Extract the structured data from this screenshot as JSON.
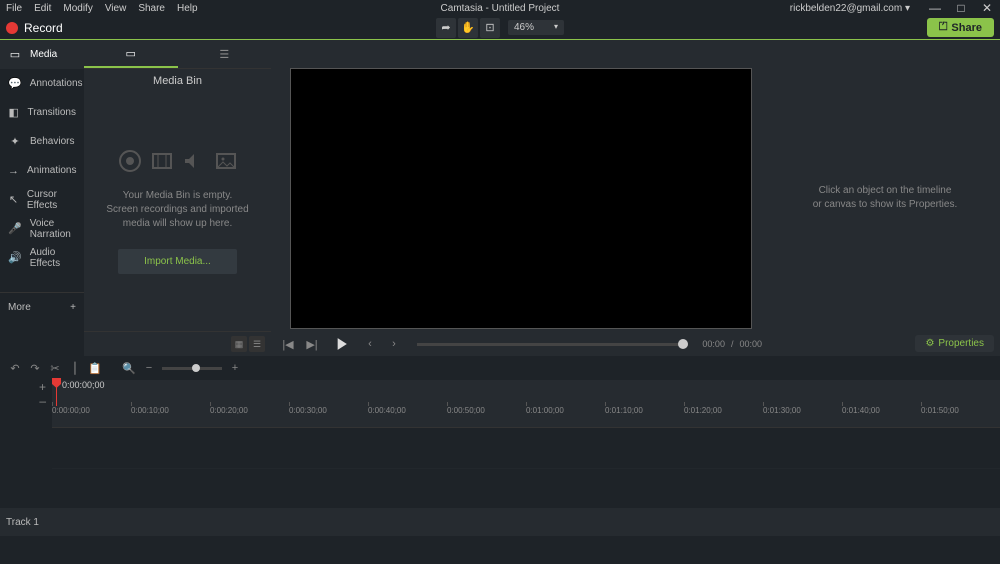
{
  "menu": [
    "File",
    "Edit",
    "Modify",
    "View",
    "Share",
    "Help"
  ],
  "title": "Camtasia - Untitled Project",
  "account": {
    "email": "rickbelden22@gmail.com"
  },
  "record": {
    "label": "Record"
  },
  "canvas_toolbar": {
    "zoom": "46%"
  },
  "share": {
    "label": "Share"
  },
  "sidebar": {
    "items": [
      {
        "label": "Media"
      },
      {
        "label": "Annotations"
      },
      {
        "label": "Transitions"
      },
      {
        "label": "Behaviors"
      },
      {
        "label": "Animations"
      },
      {
        "label": "Cursor Effects"
      },
      {
        "label": "Voice Narration"
      },
      {
        "label": "Audio Effects"
      }
    ],
    "more": "More"
  },
  "panel": {
    "title": "Media Bin",
    "empty_line1": "Your Media Bin is empty.",
    "empty_line2": "Screen recordings and imported",
    "empty_line3": "media will show up here.",
    "import": "Import Media..."
  },
  "properties": {
    "placeholder_line1": "Click an object on the timeline",
    "placeholder_line2": "or canvas to show its Properties.",
    "button": "Properties"
  },
  "playback": {
    "current": "00:00",
    "sep": "/",
    "total": "00:00"
  },
  "timeline": {
    "playhead": "0:00:00;00",
    "ticks": [
      "0:00:00;00",
      "0:00:10;00",
      "0:00:20;00",
      "0:00:30;00",
      "0:00:40;00",
      "0:00:50;00",
      "0:01:00;00",
      "0:01:10;00",
      "0:01:20;00",
      "0:01:30;00",
      "0:01:40;00",
      "0:01:50;00"
    ],
    "track1": "Track 1",
    "add": "+",
    "collapse": "–"
  }
}
